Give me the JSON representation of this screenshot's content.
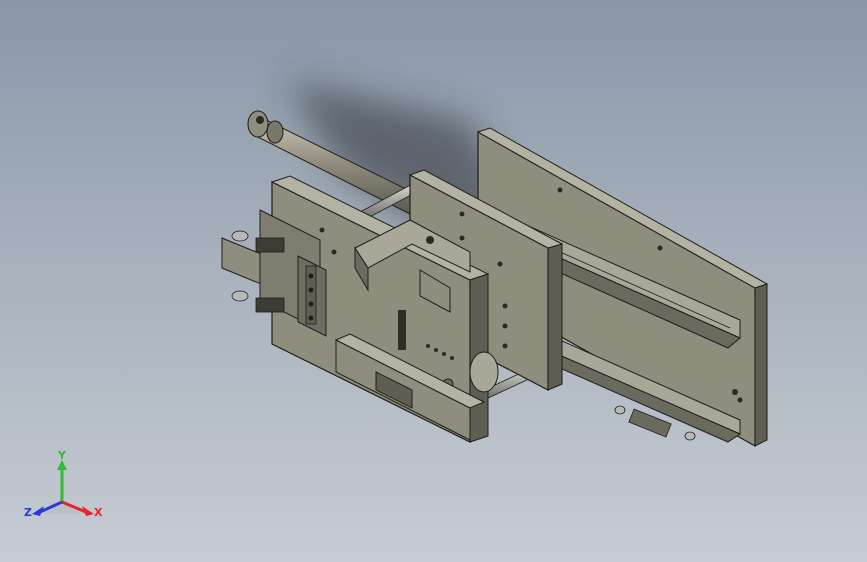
{
  "triad": {
    "x_label": "X",
    "y_label": "Y",
    "z_label": "Z",
    "x_color": "#e8242b",
    "y_color": "#2fbf2f",
    "z_color": "#2b3bd6"
  },
  "colors": {
    "background_top": "#8a97a8",
    "background_bottom": "#c6ccd3",
    "part_face": "#8f8d7e",
    "part_light": "#a9a798",
    "part_dark": "#5f5e54",
    "edge": "#1e1e1a",
    "rod": "#b9b9b5"
  }
}
